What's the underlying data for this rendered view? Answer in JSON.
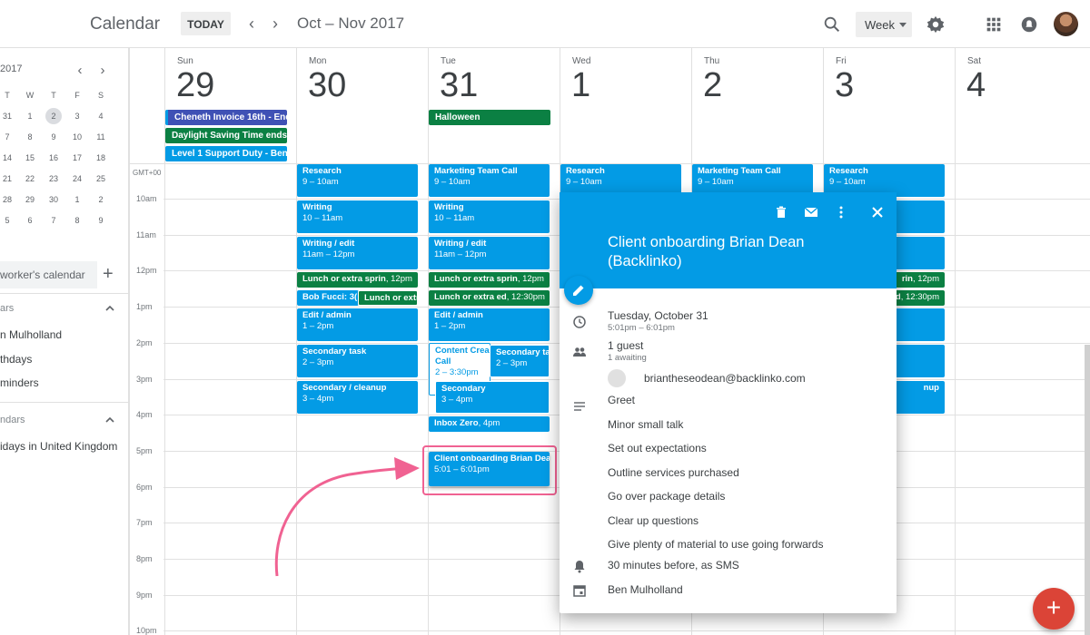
{
  "header": {
    "app_title": "Calendar",
    "today_label": "TODAY",
    "prev_icon": "chevron-left-icon",
    "next_icon": "chevron-right-icon",
    "date_range": "Oct – Nov 2017",
    "view_label": "Week"
  },
  "sidebar": {
    "mini_title": "2017",
    "weekdays": [
      "T",
      "W",
      "T",
      "F",
      "S"
    ],
    "weeks": [
      [
        "31",
        "1",
        "2",
        "3",
        "4"
      ],
      [
        "7",
        "8",
        "9",
        "10",
        "11"
      ],
      [
        "14",
        "15",
        "16",
        "17",
        "18"
      ],
      [
        "21",
        "22",
        "23",
        "24",
        "25"
      ],
      [
        "28",
        "29",
        "30",
        "1",
        "2"
      ],
      [
        "5",
        "6",
        "7",
        "8",
        "9"
      ]
    ],
    "search_placeholder": "worker's calendar",
    "my_section": "ars",
    "my_items": [
      "n Mulholland",
      "thdays",
      "minders"
    ],
    "other_section": "ndars",
    "other_items": [
      "idays in United Kingdom"
    ]
  },
  "days": [
    {
      "name": "Sun",
      "num": "29"
    },
    {
      "name": "Mon",
      "num": "30"
    },
    {
      "name": "Tue",
      "num": "31"
    },
    {
      "name": "Wed",
      "num": "1"
    },
    {
      "name": "Thu",
      "num": "2"
    },
    {
      "name": "Fri",
      "num": "3"
    },
    {
      "name": "Sat",
      "num": "4"
    }
  ],
  "allday": {
    "cheneth": "Cheneth Invoice 16th - End",
    "dst": "Daylight Saving Time ends",
    "support": "Level 1 Support Duty - Ben",
    "halloween": "Halloween"
  },
  "timezone": "GMT+00",
  "hours": [
    "10am",
    "11am",
    "12pm",
    "1pm",
    "2pm",
    "3pm",
    "4pm",
    "5pm",
    "6pm",
    "7pm",
    "8pm",
    "9pm",
    "10pm"
  ],
  "events": {
    "mon_research": {
      "title": "Research",
      "time": "9 – 10am"
    },
    "mon_writing": {
      "title": "Writing",
      "time": "10 – 11am"
    },
    "mon_edit": {
      "title": "Writing / edit",
      "time": "11am – 12pm"
    },
    "mon_lunch": {
      "title": "Lunch or extra sprin",
      "time": "12pm"
    },
    "mon_bob": {
      "title": "Bob Fucci: 3(",
      "time": ""
    },
    "mon_lunch2": {
      "title": "Lunch or extr",
      "time": ""
    },
    "mon_admin": {
      "title": "Edit / admin",
      "time": "1 – 2pm"
    },
    "mon_secondary": {
      "title": "Secondary task",
      "time": "2 – 3pm"
    },
    "mon_cleanup": {
      "title": "Secondary / cleanup",
      "time": "3 – 4pm"
    },
    "tue_marketing": {
      "title": "Marketing Team Call",
      "time": "9 – 10am"
    },
    "tue_writing": {
      "title": "Writing",
      "time": "10 – 11am"
    },
    "tue_edit": {
      "title": "Writing / edit",
      "time": "11am – 12pm"
    },
    "tue_lunch": {
      "title": "Lunch or extra sprin",
      "time": "12pm"
    },
    "tue_lunch2": {
      "title": "Lunch or extra ed",
      "time": "12:30pm"
    },
    "tue_admin": {
      "title": "Edit / admin",
      "time": "1 – 2pm"
    },
    "tue_content": {
      "title": "Content Crea",
      "title2": "Call",
      "time": "2 – 3:30pm"
    },
    "tue_secondary_task": {
      "title": "Secondary tas",
      "time": "2 – 3pm"
    },
    "tue_secondary": {
      "title": "Secondary",
      "time": "3 – 4pm"
    },
    "tue_inbox": {
      "title": "Inbox Zero",
      "time": "4pm"
    },
    "tue_client": {
      "title": "Client onboarding Brian Dean",
      "time": "5:01 – 6:01pm"
    },
    "wed_research": {
      "title": "Research",
      "time": "9 – 10am"
    },
    "thu_marketing": {
      "title": "Marketing Team Call",
      "time": "9 – 10am"
    },
    "fri_research": {
      "title": "Research",
      "time": "9 – 10am"
    },
    "fri_lunch": {
      "title": "rin",
      "time": "12pm"
    },
    "fri_lunch2": {
      "title": "d",
      "time": "12:30pm"
    },
    "fri_cleanup": {
      "title": "nup",
      "time": ""
    }
  },
  "popup": {
    "title": "Client onboarding Brian Dean (Backlinko)",
    "date": "Tuesday, October 31",
    "time": "5:01pm – 6:01pm",
    "guests": "1 guest",
    "guests_sub": "1 awaiting",
    "guest_email": "briantheseodean@backlinko.com",
    "agenda": [
      "Greet",
      "Minor small talk",
      "Set out expectations",
      "Outline services purchased",
      "Go over package details",
      "Clear up questions",
      "Give plenty of material to use going forwards"
    ],
    "reminder": "30 minutes before, as SMS",
    "calendar": "Ben Mulholland"
  },
  "colors": {
    "event_blue": "#039be5",
    "event_green": "#0b8043",
    "allday_purple": "#3f51b5",
    "fab_red": "#db4437",
    "highlight_pink": "#f06292"
  }
}
